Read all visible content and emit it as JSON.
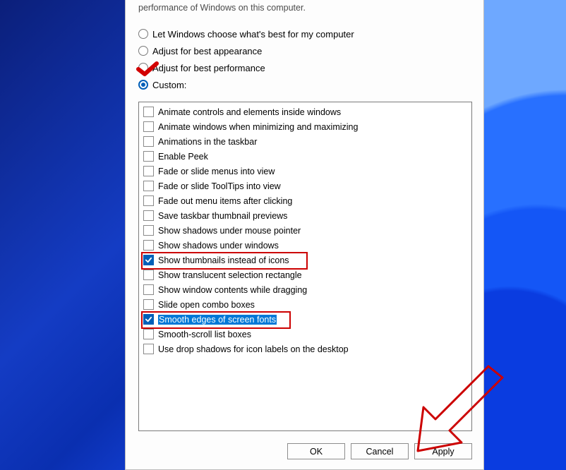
{
  "header_fragment": "performance of Windows on this computer.",
  "radios": [
    {
      "label": "Let Windows choose what's best for my computer",
      "selected": false
    },
    {
      "label": "Adjust for best appearance",
      "selected": false
    },
    {
      "label": "Adjust for best performance",
      "selected": false
    },
    {
      "label": "Custom:",
      "selected": true
    }
  ],
  "options": [
    {
      "label": "Animate controls and elements inside windows",
      "checked": false,
      "highlight": false,
      "redbox": false
    },
    {
      "label": "Animate windows when minimizing and maximizing",
      "checked": false,
      "highlight": false,
      "redbox": false
    },
    {
      "label": "Animations in the taskbar",
      "checked": false,
      "highlight": false,
      "redbox": false
    },
    {
      "label": "Enable Peek",
      "checked": false,
      "highlight": false,
      "redbox": false
    },
    {
      "label": "Fade or slide menus into view",
      "checked": false,
      "highlight": false,
      "redbox": false
    },
    {
      "label": "Fade or slide ToolTips into view",
      "checked": false,
      "highlight": false,
      "redbox": false
    },
    {
      "label": "Fade out menu items after clicking",
      "checked": false,
      "highlight": false,
      "redbox": false
    },
    {
      "label": "Save taskbar thumbnail previews",
      "checked": false,
      "highlight": false,
      "redbox": false
    },
    {
      "label": "Show shadows under mouse pointer",
      "checked": false,
      "highlight": false,
      "redbox": false
    },
    {
      "label": "Show shadows under windows",
      "checked": false,
      "highlight": false,
      "redbox": false
    },
    {
      "label": "Show thumbnails instead of icons",
      "checked": true,
      "highlight": false,
      "redbox": true
    },
    {
      "label": "Show translucent selection rectangle",
      "checked": false,
      "highlight": false,
      "redbox": false
    },
    {
      "label": "Show window contents while dragging",
      "checked": false,
      "highlight": false,
      "redbox": false
    },
    {
      "label": "Slide open combo boxes",
      "checked": false,
      "highlight": false,
      "redbox": false
    },
    {
      "label": "Smooth edges of screen fonts",
      "checked": true,
      "highlight": true,
      "redbox": true
    },
    {
      "label": "Smooth-scroll list boxes",
      "checked": false,
      "highlight": false,
      "redbox": false
    },
    {
      "label": "Use drop shadows for icon labels on the desktop",
      "checked": false,
      "highlight": false,
      "redbox": false
    }
  ],
  "buttons": {
    "ok": "OK",
    "cancel": "Cancel",
    "apply": "Apply"
  }
}
